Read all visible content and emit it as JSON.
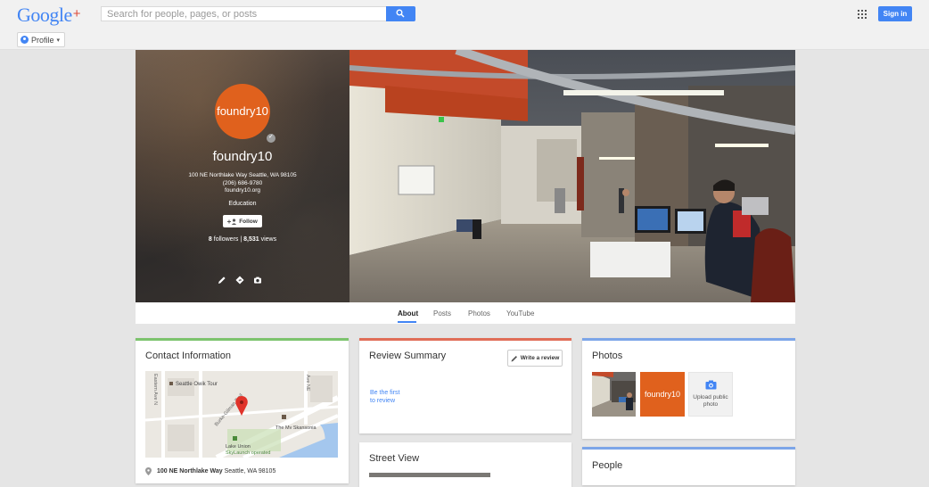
{
  "header": {
    "logo_text": "Google",
    "logo_plus": "+",
    "search_placeholder": "Search for people, pages, or posts",
    "sign_in": "Sign in"
  },
  "subbar": {
    "profile_label": "Profile"
  },
  "profile": {
    "avatar_text": "foundry10",
    "name": "foundry10",
    "address": "100 NE Northlake Way Seattle, WA 98105",
    "phone": "(206) 686-9780",
    "website": "foundry10.org",
    "category": "Education",
    "follow_label": "Follow",
    "followers_count": "8",
    "followers_label": "followers",
    "separator": "|",
    "views_count": "8,531",
    "views_label": "views"
  },
  "tabs": [
    {
      "label": "About"
    },
    {
      "label": "Posts"
    },
    {
      "label": "Photos"
    },
    {
      "label": "YouTube"
    }
  ],
  "contact": {
    "title": "Contact Information",
    "map_labels": {
      "tour": "Seattle Owik Tour",
      "street_1": "Burke-Gilman Trail",
      "street_2": "Eastern Ave N",
      "street_3": "Ave NE",
      "ship": "The Mv Skansonia",
      "park_1": "Lake Union",
      "park_2": "SkyLaunch operated"
    },
    "address_bold": "100 NE Northlake Way",
    "address_rest": "Seattle, WA 98105"
  },
  "review": {
    "title": "Review Summary",
    "write_label": "Write a review",
    "first_line1": "Be the first",
    "first_line2": "to review"
  },
  "photos": {
    "title": "Photos",
    "logo_text": "foundry10",
    "upload_line1": "Upload public",
    "upload_line2": "photo"
  },
  "street": {
    "title": "Street View"
  },
  "people": {
    "title": "People"
  },
  "colors": {
    "brand_orange": "#e0611d",
    "google_blue": "#4285f4",
    "contact_accent": "#7cc36d",
    "review_accent": "#e06d57",
    "photos_accent": "#7ca5e8"
  }
}
